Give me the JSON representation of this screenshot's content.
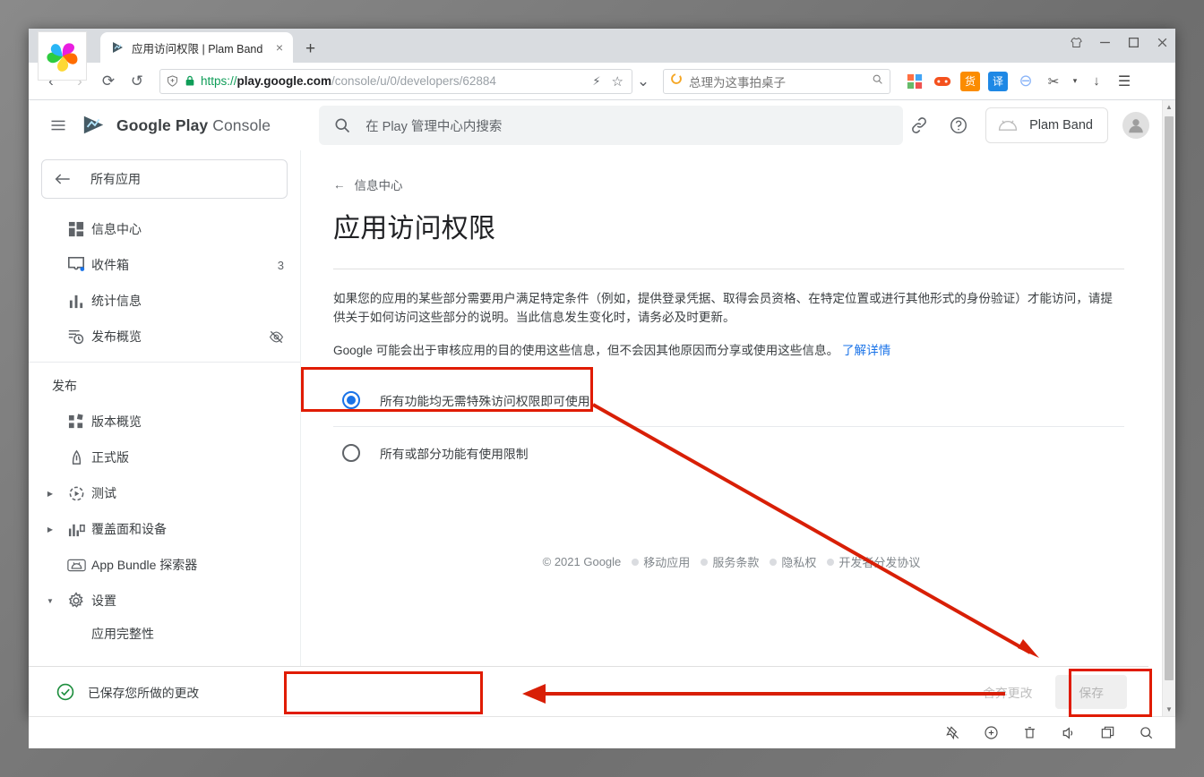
{
  "browser": {
    "tab": {
      "title": "应用访问权限 | Plam Band",
      "close_label": "×",
      "favicon": "play-console-favicon"
    },
    "new_tab_label": "+",
    "window_controls": {
      "theme": "skin-icon",
      "minimize": "–",
      "maximize": "□",
      "close": "✕"
    },
    "nav": {
      "back": "‹",
      "forward": "›",
      "reload": "⟳",
      "undo": "↺"
    },
    "omnibox": {
      "shield": "shield-icon",
      "lock": "lock-icon",
      "scheme": "https://",
      "host": "play.google.com",
      "path": "/console/u/0/developers/62884",
      "lightning": "⚡",
      "star": "☆",
      "chevron": "⌄"
    },
    "search": {
      "engine_icon": "O",
      "value": "总理为这事拍桌子",
      "submit_icon": "search-icon"
    },
    "extensions": [
      {
        "name": "apps-grid-extension",
        "glyph": "▦",
        "color": "#ff7043"
      },
      {
        "name": "game-controller-extension",
        "glyph": "🎮",
        "color": "#f4511e"
      },
      {
        "name": "coupon-extension",
        "glyph": "货",
        "color": "#fb8c00"
      },
      {
        "name": "translate-extension",
        "glyph": "译",
        "color": "#1e88e5"
      },
      {
        "name": "adblock-extension",
        "glyph": "⊖",
        "color": "#8ab4f8"
      },
      {
        "name": "screenshot-extension",
        "glyph": "✂",
        "color": "#4d4d4d"
      },
      {
        "name": "downloads-extension",
        "glyph": "↓",
        "color": "#4d4d4d"
      },
      {
        "name": "menu-extension",
        "glyph": "☰",
        "color": "#4d4d4d"
      }
    ]
  },
  "console": {
    "brand": {
      "google": "Google Play",
      "console": "Console"
    },
    "menu_icon": "hamburger-icon",
    "search_placeholder": "在 Play 管理中心内搜索",
    "link_icon": "link-icon",
    "help_icon": "help-icon",
    "app_chip": {
      "name": "Plam Band",
      "icon": "android-icon"
    },
    "account_icon": "account-avatar"
  },
  "sidebar": {
    "all_apps": "所有应用",
    "back_arrow": "←",
    "items": [
      {
        "label": "信息中心",
        "icon": "dashboard-icon",
        "trailing": "",
        "caret": false
      },
      {
        "label": "收件箱",
        "icon": "inbox-icon",
        "trailing": "3",
        "caret": false
      },
      {
        "label": "统计信息",
        "icon": "statistics-icon",
        "trailing": "",
        "caret": false
      },
      {
        "label": "发布概览",
        "icon": "publishing-overview-icon",
        "trailing": "eye-off-icon",
        "caret": false
      }
    ],
    "section_title": "发布",
    "publish_items": [
      {
        "label": "版本概览",
        "icon": "release-overview-icon",
        "caret": ""
      },
      {
        "label": "正式版",
        "icon": "production-icon",
        "caret": ""
      },
      {
        "label": "测试",
        "icon": "testing-icon",
        "caret": "▶"
      },
      {
        "label": "覆盖面和设备",
        "icon": "reach-devices-icon",
        "caret": "▶"
      },
      {
        "label": "App Bundle 探索器",
        "icon": "app-bundle-icon",
        "caret": ""
      },
      {
        "label": "设置",
        "icon": "settings-gear-icon",
        "caret": "▼"
      }
    ],
    "sub_item": "应用完整性"
  },
  "main": {
    "breadcrumb": "信息中心",
    "breadcrumb_arrow": "←",
    "title": "应用访问权限",
    "paragraph1": "如果您的应用的某些部分需要用户满足特定条件（例如，提供登录凭据、取得会员资格、在特定位置或进行其他形式的身份验证）才能访问，请提供关于如何访问这些部分的说明。当此信息发生变化时，请务必及时更新。",
    "paragraph2_text": "Google 可能会出于审核应用的目的使用这些信息，但不会因其他原因而分享或使用这些信息。",
    "paragraph2_link": "了解详情",
    "options": [
      {
        "label": "所有功能均无需特殊访问权限即可使用",
        "selected": true
      },
      {
        "label": "所有或部分功能有使用限制",
        "selected": false
      }
    ],
    "footer": {
      "copyright": "© 2021 Google",
      "links": [
        "移动应用",
        "服务条款",
        "隐私权",
        "开发者分发协议"
      ]
    }
  },
  "action_bar": {
    "saved_message": "已保存您所做的更改",
    "saved_icon": "check-circle-icon",
    "discard_label": "舍弃更改",
    "save_label": "保存"
  },
  "taskbar": {
    "icons": [
      "pin-off-icon",
      "eyedropper-icon",
      "trash-icon",
      "volume-icon",
      "window-icon",
      "search-icon"
    ]
  },
  "colors": {
    "accent_blue": "#1a73e8",
    "annotation_red": "#e01b00",
    "success_green": "#1e8e3e",
    "scheme_green": "#0f9d58"
  }
}
